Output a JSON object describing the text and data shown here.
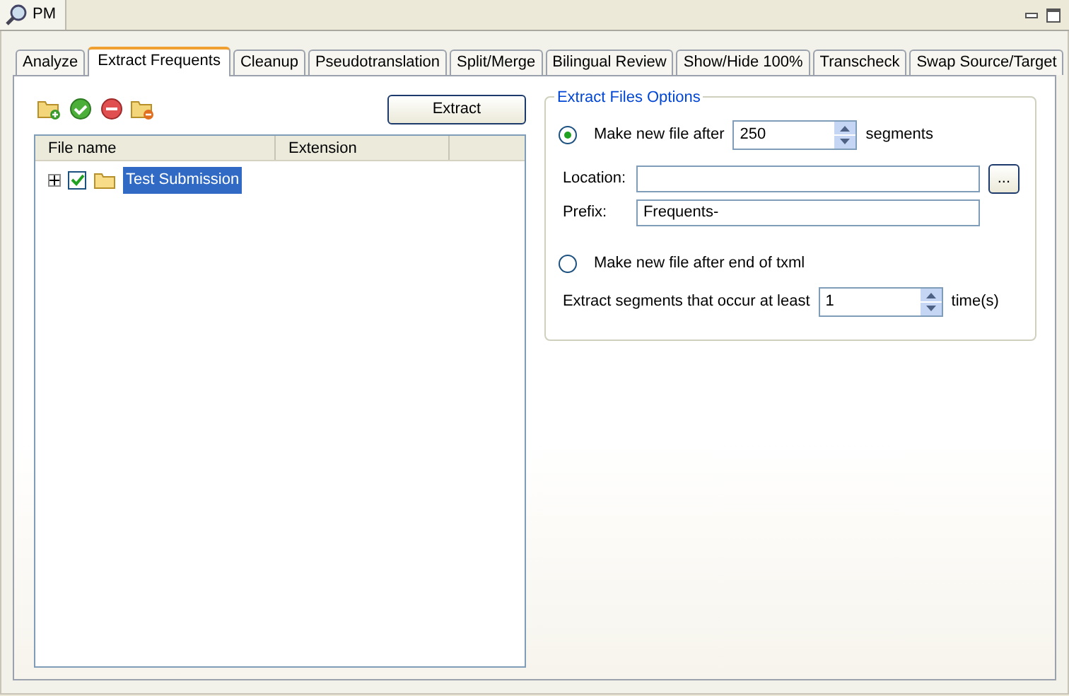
{
  "view_tab": {
    "title": "PM"
  },
  "tabs": [
    {
      "label": "Analyze",
      "selected": false
    },
    {
      "label": "Extract Frequents",
      "selected": true
    },
    {
      "label": "Cleanup",
      "selected": false
    },
    {
      "label": "Pseudotranslation",
      "selected": false
    },
    {
      "label": "Split/Merge",
      "selected": false
    },
    {
      "label": "Bilingual Review",
      "selected": false
    },
    {
      "label": "Show/Hide 100%",
      "selected": false
    },
    {
      "label": "Transcheck",
      "selected": false
    },
    {
      "label": "Swap Source/Target",
      "selected": false
    }
  ],
  "extract_button": "Extract",
  "tree": {
    "columns": [
      "File name",
      "Extension"
    ],
    "items": [
      {
        "label": "Test Submission",
        "checked": true,
        "expanded": false,
        "selected": true
      }
    ]
  },
  "options": {
    "title": "Extract Files Options",
    "split_by_count": {
      "label": "Make new file after",
      "selected": true,
      "value": "250",
      "suffix": "segments"
    },
    "location": {
      "label": "Location:",
      "browse": "..."
    },
    "prefix": {
      "label": "Prefix:",
      "value": "Frequents-"
    },
    "split_by_end": {
      "label": "Make new file after end of txml",
      "selected": false
    },
    "occurrence": {
      "label": "Extract segments that occur at least",
      "value": "1",
      "suffix": "time(s)"
    }
  }
}
